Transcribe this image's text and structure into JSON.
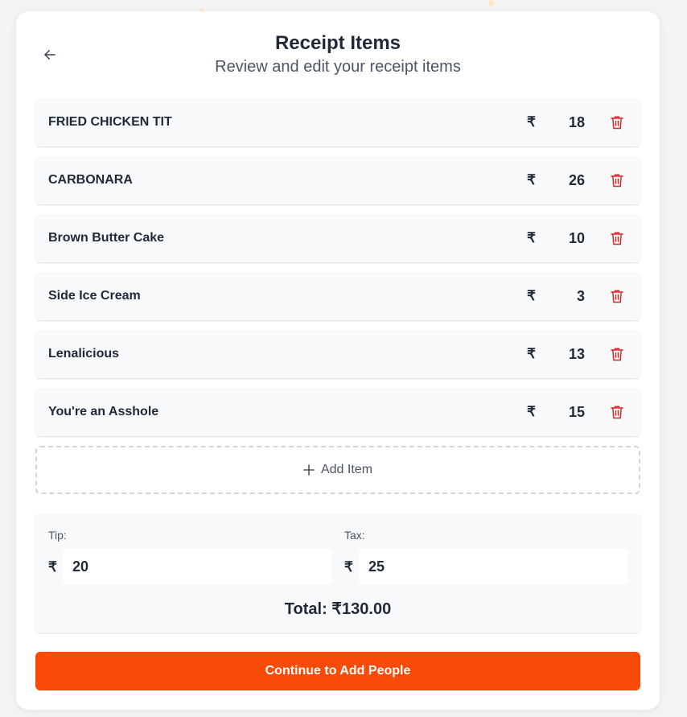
{
  "header": {
    "title": "Receipt Items",
    "subtitle": "Review and edit your receipt items"
  },
  "currency_symbol": "₹",
  "items": [
    {
      "name": "FRIED CHICKEN TIT",
      "price": "18"
    },
    {
      "name": "CARBONARA",
      "price": "26"
    },
    {
      "name": "Brown Butter Cake",
      "price": "10"
    },
    {
      "name": "Side Ice Cream",
      "price": "3"
    },
    {
      "name": "Lenalicious",
      "price": "13"
    },
    {
      "name": "You're an Asshole",
      "price": "15"
    }
  ],
  "add_item_label": "Add Item",
  "summary": {
    "tip_label": "Tip:",
    "tip_value": "20",
    "tax_label": "Tax:",
    "tax_value": "25",
    "total": "Total: ₹130.00"
  },
  "continue_label": "Continue to Add People",
  "colors": {
    "accent": "#f84b07",
    "delete": "#dc2626",
    "text": "#1f2937",
    "muted": "#4b5563"
  },
  "icons": {
    "back": "arrow-left-icon",
    "delete": "trash-icon",
    "add": "plus-icon"
  }
}
